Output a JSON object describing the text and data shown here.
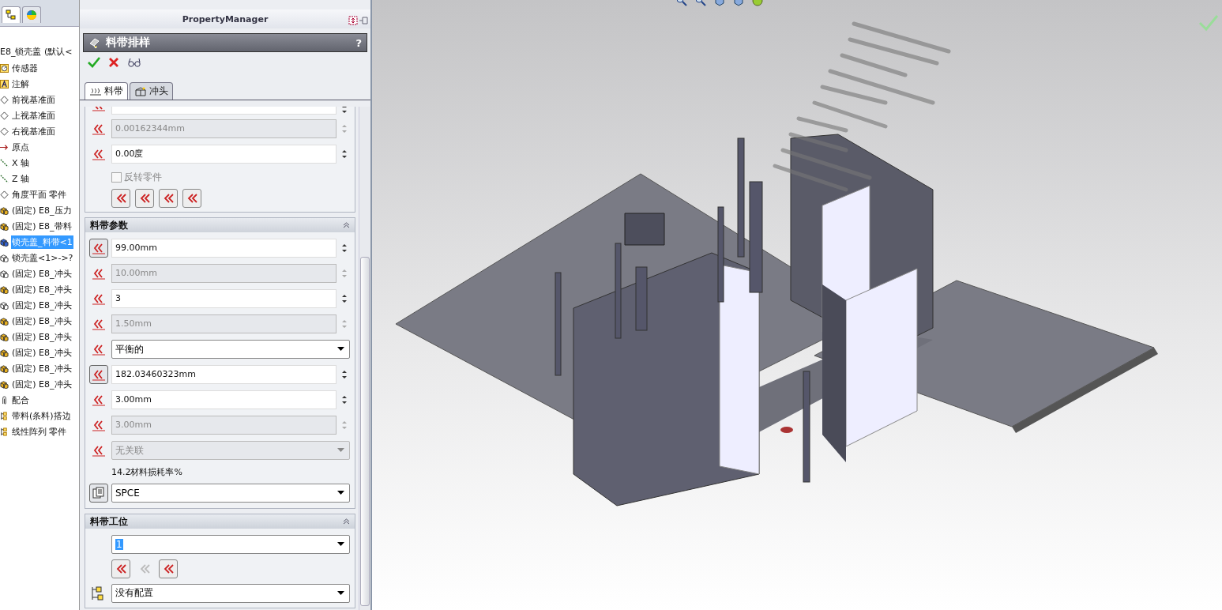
{
  "tree": {
    "tabs": [
      {
        "kind": "feature-tree",
        "selected": true
      },
      {
        "kind": "appearance",
        "selected": false
      }
    ],
    "root": "E8_锁壳盖 (默认<",
    "items": [
      {
        "label": "传感器",
        "kind": "sensor",
        "selected": false
      },
      {
        "label": "注解",
        "kind": "annotation",
        "selected": false
      },
      {
        "label": "前视基准面",
        "kind": "plane",
        "selected": false
      },
      {
        "label": "上视基准面",
        "kind": "plane",
        "selected": false
      },
      {
        "label": "右视基准面",
        "kind": "plane",
        "selected": false
      },
      {
        "label": "原点",
        "kind": "origin",
        "selected": false
      },
      {
        "label": "X 轴",
        "kind": "axis",
        "selected": false
      },
      {
        "label": "Z 轴",
        "kind": "axis",
        "selected": false
      },
      {
        "label": "角度平面 零件",
        "kind": "plane",
        "selected": false
      },
      {
        "label": "(固定) E8_压力",
        "kind": "part-fixed",
        "selected": false
      },
      {
        "label": "(固定) E8_带料",
        "kind": "part-fixed",
        "selected": false
      },
      {
        "label": "锁壳盖_料带<1",
        "kind": "part-active",
        "selected": true
      },
      {
        "label": "锁壳盖<1>->?",
        "kind": "part-outline",
        "selected": false
      },
      {
        "label": "(固定) E8_冲头",
        "kind": "part-outline",
        "selected": false
      },
      {
        "label": "(固定) E8_冲头",
        "kind": "part-fixed",
        "selected": false
      },
      {
        "label": "(固定) E8_冲头",
        "kind": "part-outline",
        "selected": false
      },
      {
        "label": "(固定) E8_冲头",
        "kind": "part-fixed",
        "selected": false
      },
      {
        "label": "(固定) E8_冲头",
        "kind": "part-fixed",
        "selected": false
      },
      {
        "label": "(固定) E8_冲头",
        "kind": "part-fixed",
        "selected": false
      },
      {
        "label": "(固定) E8_冲头",
        "kind": "part-fixed",
        "selected": false
      },
      {
        "label": "(固定) E8_冲头",
        "kind": "part-fixed",
        "selected": false
      },
      {
        "label": "配合",
        "kind": "mate",
        "selected": false
      },
      {
        "label": "带料(条料)搭边",
        "kind": "feature",
        "selected": false
      },
      {
        "label": "线性阵列 零件",
        "kind": "feature",
        "selected": false
      }
    ]
  },
  "property_manager": {
    "title": "PropertyManager",
    "feature_title": "料带排样",
    "help": "?",
    "tabs": [
      {
        "label": "料带",
        "selected": true
      },
      {
        "label": "冲头",
        "selected": false
      }
    ],
    "groups": [
      {
        "rows": [
          {
            "kind": "spin",
            "icon_framed": false,
            "disabled": false
          },
          {
            "kind": "spin",
            "icon_framed": false,
            "value": "0.00162344mm",
            "disabled": true
          },
          {
            "kind": "spin",
            "icon_framed": false,
            "value": "0.00度",
            "disabled": false
          },
          {
            "kind": "checkbox",
            "label": "反转零件",
            "checked": false,
            "disabled": true
          },
          {
            "kind": "buttons",
            "buttons": [
              {
                "disabled": false
              },
              {
                "disabled": false
              },
              {
                "disabled": false
              },
              {
                "disabled": false
              }
            ]
          }
        ]
      },
      {
        "title": "料带参数",
        "rows": [
          {
            "kind": "spin",
            "icon_framed": true,
            "value": "99.00mm",
            "disabled": false
          },
          {
            "kind": "spin",
            "icon_framed": false,
            "value": "10.00mm",
            "disabled": true
          },
          {
            "kind": "spin",
            "icon_framed": false,
            "value": "3",
            "disabled": false
          },
          {
            "kind": "spin",
            "icon_framed": false,
            "value": "1.50mm",
            "disabled": true
          },
          {
            "kind": "dropdown",
            "icon_framed": false,
            "value": "平衡的",
            "disabled": false
          },
          {
            "kind": "spin",
            "icon_framed": true,
            "value": "182.03460323mm",
            "disabled": false
          },
          {
            "kind": "spin",
            "icon_framed": false,
            "value": "3.00mm",
            "disabled": false
          },
          {
            "kind": "spin",
            "icon_framed": false,
            "value": "3.00mm",
            "disabled": true
          },
          {
            "kind": "dropdown",
            "icon_framed": false,
            "value": "无关联",
            "disabled": true
          },
          {
            "kind": "note",
            "text": "14.2材料损耗率%"
          },
          {
            "kind": "material-dropdown",
            "icon_framed": true,
            "value": "SPCE",
            "disabled": false
          }
        ]
      },
      {
        "title": "料带工位",
        "rows": [
          {
            "kind": "station-dropdown",
            "value": "1",
            "text_highlighted": true
          },
          {
            "kind": "buttons",
            "buttons": [
              {
                "disabled": false
              },
              {
                "disabled": true
              },
              {
                "disabled": false
              }
            ]
          },
          {
            "kind": "config-dropdown",
            "icon_framed": false,
            "value": "没有配置",
            "disabled": false
          }
        ]
      }
    ]
  }
}
